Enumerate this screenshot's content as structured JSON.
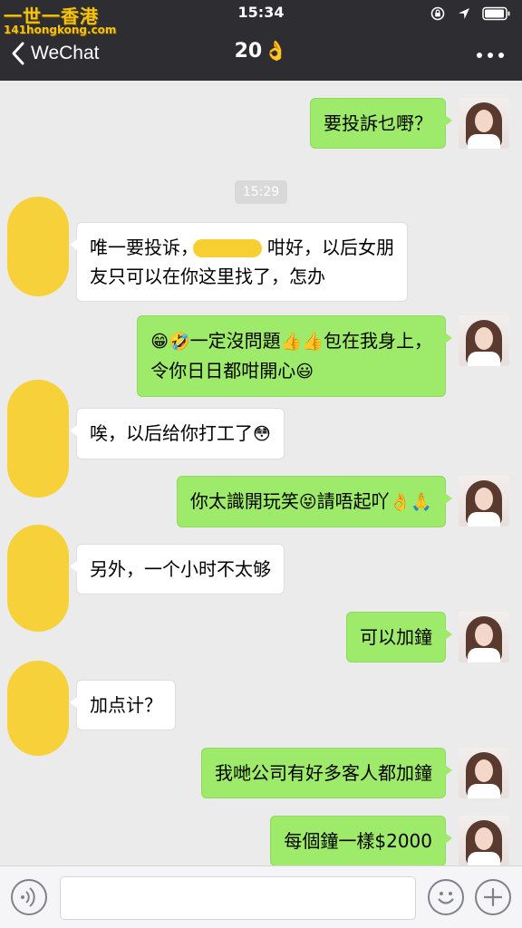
{
  "status_bar": {
    "watermark_main": "一世一香港",
    "watermark_sub": "141hongkong.com",
    "time": "15:34",
    "icons": [
      "rotation-lock-icon",
      "location-arrow-icon",
      "battery-icon"
    ]
  },
  "nav": {
    "back_label": "WeChat",
    "title": "20",
    "title_emoji": "👌",
    "more_icon": "more-icon"
  },
  "chat": {
    "timestamp": "15:29",
    "messages": [
      {
        "side": "out",
        "text": "要投訴乜嘢？"
      },
      {
        "side": "in",
        "line1": "唯一要投诉，",
        "line1_after": "咁好，以后女朋",
        "line2": "友只可以在你这里找了，怎办"
      },
      {
        "side": "out",
        "line1_emoji": "😁🤣",
        "line1_a": "一定沒問題",
        "line1_emoji2": "👍👍",
        "line1_b": "包在我身上，",
        "line2": "令你日日都咁開心",
        "line2_emoji": "😃"
      },
      {
        "side": "in",
        "text": "唉，以后给你打工了",
        "emoji": "😳"
      },
      {
        "side": "out",
        "text_a": "你太識開玩笑",
        "emoji1": "😝",
        "text_b": "請唔起吖",
        "emoji2": "👌🙏"
      },
      {
        "side": "in",
        "text": "另外，一个小时不太够"
      },
      {
        "side": "out",
        "text": "可以加鐘"
      },
      {
        "side": "in",
        "text": "加点计？"
      },
      {
        "side": "out",
        "text": "我哋公司有好多客人都加鐘"
      },
      {
        "side": "out",
        "text": "每個鐘一樣$2000"
      }
    ]
  },
  "input_bar": {
    "placeholder": "",
    "icons": [
      "voice-icon",
      "emoji-icon",
      "plus-icon"
    ]
  },
  "colors": {
    "header_bg": "#2e2e32",
    "chat_bg": "#ebebeb",
    "bubble_out": "#9eea6a",
    "bubble_in": "#ffffff",
    "redaction": "#f7cf33"
  }
}
